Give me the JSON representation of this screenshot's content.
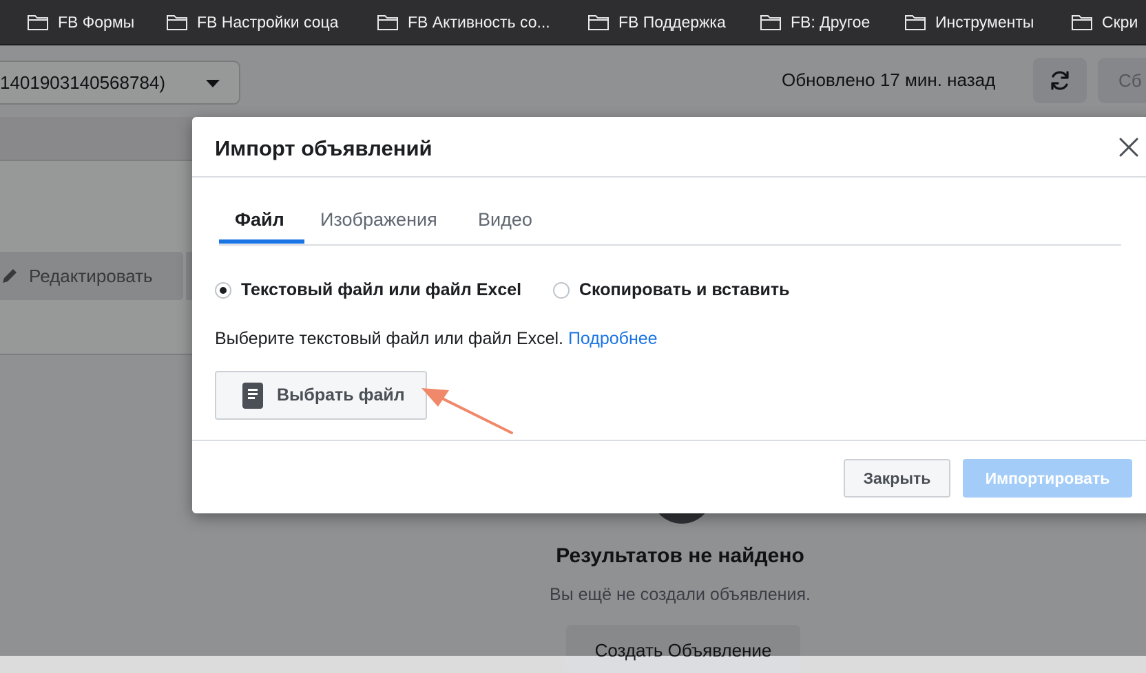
{
  "bookmarks": [
    {
      "label": "."
    },
    {
      "label": "FB Формы"
    },
    {
      "label": "FB Настройки соца"
    },
    {
      "label": "FB Активность со..."
    },
    {
      "label": "FB Поддержка"
    },
    {
      "label": "FB: Другое"
    },
    {
      "label": "Инструменты"
    },
    {
      "label": "Скри"
    }
  ],
  "page": {
    "account_select_text": "1401903140568784)",
    "updated_text": "Обновлено 17 мин. назад",
    "clipped_button_text": "Сб",
    "edit_button_label": "Редактировать",
    "empty_title": "Результатов не найдено",
    "empty_subtitle": "Вы ещё не создали объявления.",
    "create_button_label": "Создать Объявление"
  },
  "modal": {
    "title": "Импорт объявлений",
    "tabs": [
      {
        "label": "Файл",
        "active": true
      },
      {
        "label": "Изображения",
        "active": false
      },
      {
        "label": "Видео",
        "active": false
      }
    ],
    "radio_options": [
      {
        "label": "Текстовый файл или файл Excel",
        "checked": true
      },
      {
        "label": "Скопировать и вставить",
        "checked": false
      }
    ],
    "hint_text": "Выберите текстовый файл или файл Excel.",
    "hint_link": "Подробнее",
    "choose_file_label": "Выбрать файл",
    "close_button_label": "Закрыть",
    "import_button_label": "Импортировать"
  },
  "colors": {
    "accent": "#1b74e4",
    "import_disabled": "#a3cdf8",
    "annotation_arrow": "#f0886a"
  }
}
